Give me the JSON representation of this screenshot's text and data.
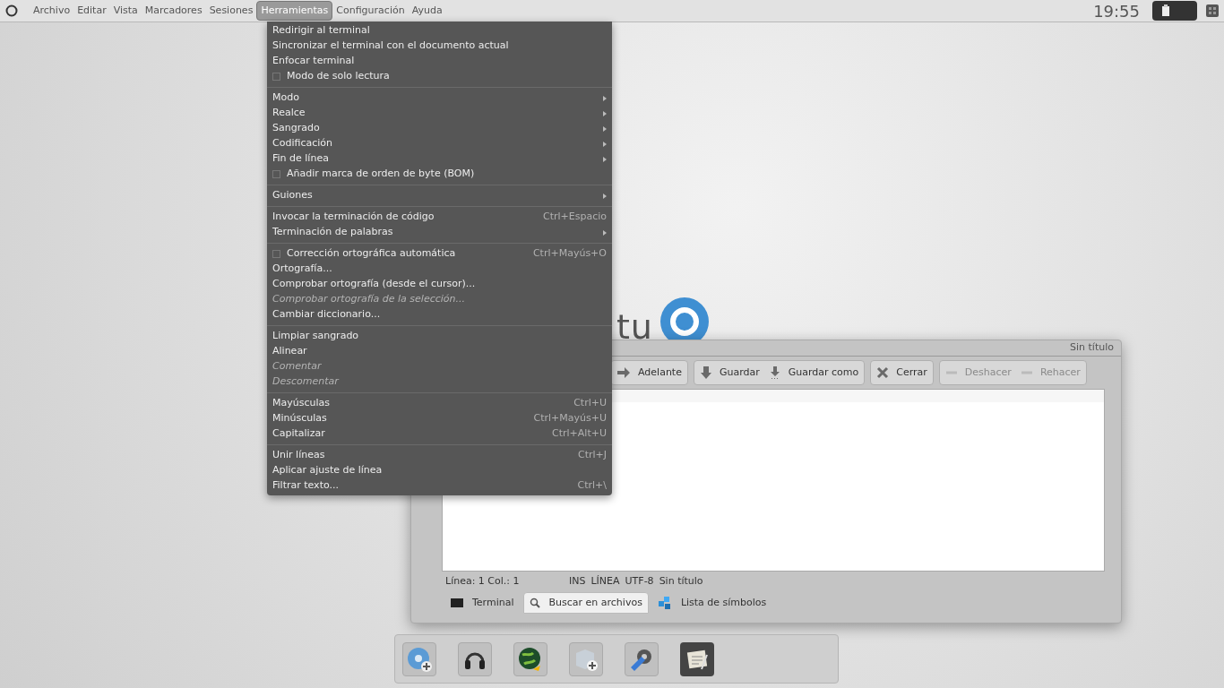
{
  "menubar": [
    {
      "label": "Archivo",
      "selected": false
    },
    {
      "label": "Editar",
      "selected": false
    },
    {
      "label": "Vista",
      "selected": false
    },
    {
      "label": "Marcadores",
      "selected": false
    },
    {
      "label": "Sesiones",
      "selected": false
    },
    {
      "label": "Herramientas",
      "selected": true
    },
    {
      "label": "Configuración",
      "selected": false
    },
    {
      "label": "Ayuda",
      "selected": false
    }
  ],
  "clock": "19:55",
  "wallpaper_logo": "tu",
  "menu": [
    [
      {
        "kind": "action",
        "label": "Redirigir al terminal",
        "disabled": false
      },
      {
        "kind": "action",
        "label": "Sincronizar el terminal con el documento actual",
        "disabled": false
      },
      {
        "kind": "action",
        "label": "Enfocar terminal",
        "disabled": false
      },
      {
        "kind": "check",
        "label": "Modo de solo lectura",
        "checked": false,
        "disabled": false
      }
    ],
    [
      {
        "kind": "submenu",
        "label": "Modo",
        "disabled": false
      },
      {
        "kind": "submenu",
        "label": "Realce",
        "disabled": false
      },
      {
        "kind": "submenu",
        "label": "Sangrado",
        "disabled": false
      },
      {
        "kind": "submenu",
        "label": "Codificación",
        "disabled": false
      },
      {
        "kind": "submenu",
        "label": "Fin de línea",
        "disabled": false
      },
      {
        "kind": "check",
        "label": "Añadir marca de orden de byte (BOM)",
        "checked": false,
        "disabled": false
      }
    ],
    [
      {
        "kind": "submenu",
        "label": "Guiones",
        "disabled": false
      }
    ],
    [
      {
        "kind": "action",
        "label": "Invocar la terminación de código",
        "shortcut": "Ctrl+Espacio",
        "disabled": false
      },
      {
        "kind": "submenu",
        "label": "Terminación de palabras",
        "disabled": false
      }
    ],
    [
      {
        "kind": "check",
        "label": "Corrección ortográfica automática",
        "shortcut": "Ctrl+Mayús+O",
        "checked": false,
        "disabled": false
      },
      {
        "kind": "action",
        "label": "Ortografía...",
        "disabled": false
      },
      {
        "kind": "action",
        "label": "Comprobar ortografía (desde el cursor)...",
        "disabled": false
      },
      {
        "kind": "action",
        "label": "Comprobar ortografía de la selección...",
        "disabled": true
      },
      {
        "kind": "action",
        "label": "Cambiar diccionario...",
        "disabled": false
      }
    ],
    [
      {
        "kind": "action",
        "label": "Limpiar sangrado",
        "disabled": false
      },
      {
        "kind": "action",
        "label": "Alinear",
        "disabled": false
      },
      {
        "kind": "action",
        "label": "Comentar",
        "disabled": true
      },
      {
        "kind": "action",
        "label": "Descomentar",
        "disabled": true
      }
    ],
    [
      {
        "kind": "action",
        "label": "Mayúsculas",
        "shortcut": "Ctrl+U",
        "disabled": false
      },
      {
        "kind": "action",
        "label": "Minúsculas",
        "shortcut": "Ctrl+Mayús+U",
        "disabled": false
      },
      {
        "kind": "action",
        "label": "Capitalizar",
        "shortcut": "Ctrl+Alt+U",
        "disabled": false
      }
    ],
    [
      {
        "kind": "action",
        "label": "Unir líneas",
        "shortcut": "Ctrl+J",
        "disabled": false
      },
      {
        "kind": "action",
        "label": "Aplicar ajuste de línea",
        "disabled": false
      },
      {
        "kind": "action",
        "label": "Filtrar texto...",
        "shortcut": "Ctrl+\\",
        "disabled": false
      }
    ]
  ],
  "editor": {
    "title": "Sin título",
    "toolbar": [
      [
        {
          "kind": "forward",
          "label": "Adelante",
          "disabled": false
        }
      ],
      [
        {
          "kind": "save",
          "label": "Guardar",
          "disabled": false
        },
        {
          "kind": "saveas",
          "label": "Guardar como",
          "disabled": false
        }
      ],
      [
        {
          "kind": "close",
          "label": "Cerrar",
          "disabled": false
        }
      ],
      [
        {
          "kind": "undo",
          "label": "Deshacer",
          "disabled": true
        },
        {
          "kind": "redo",
          "label": "Rehacer",
          "disabled": true
        }
      ]
    ],
    "status": [
      "Línea: 1 Col.: 1",
      "INS",
      "LÍNEA",
      "UTF-8",
      "Sin título"
    ],
    "bottom_tabs": [
      {
        "kind": "terminal",
        "label": "Terminal",
        "selected": false
      },
      {
        "kind": "search",
        "label": "Buscar en archivos",
        "selected": true
      },
      {
        "kind": "symbols",
        "label": "Lista de símbolos",
        "selected": false
      }
    ]
  },
  "dock": [
    {
      "kind": "disc",
      "selected": false
    },
    {
      "kind": "headphones",
      "selected": false
    },
    {
      "kind": "globe",
      "selected": false
    },
    {
      "kind": "install",
      "selected": false
    },
    {
      "kind": "media",
      "selected": false
    },
    {
      "kind": "notes",
      "selected": true
    }
  ]
}
